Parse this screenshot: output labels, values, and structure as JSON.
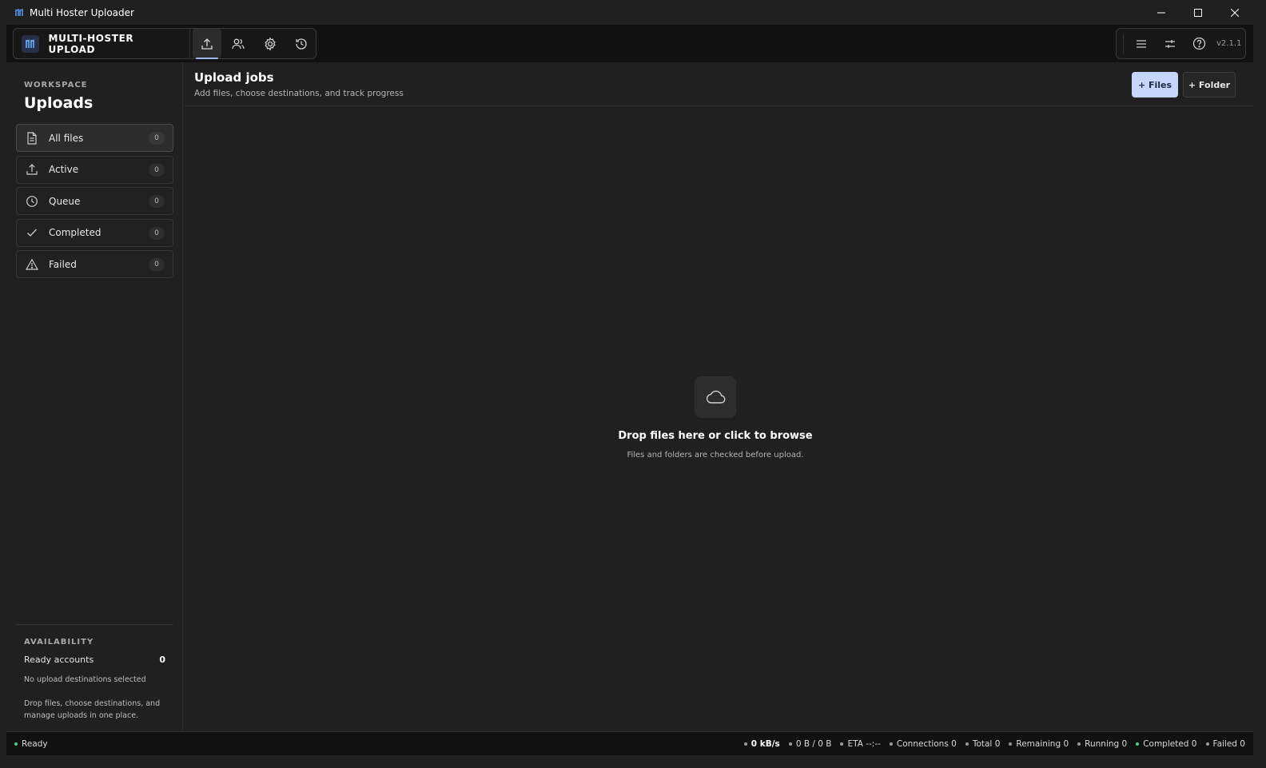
{
  "window": {
    "title": "Multi Hoster Uploader"
  },
  "header": {
    "brand": "MULTI-HOSTER UPLOAD",
    "nav": [
      "upload",
      "accounts",
      "settings",
      "history"
    ],
    "version": "v2.1.1"
  },
  "sidebar": {
    "workspace_label": "WORKSPACE",
    "workspace_title": "Uploads",
    "items": [
      {
        "label": "All files",
        "count": "0",
        "icon": "file-icon",
        "active": true
      },
      {
        "label": "Active",
        "count": "0",
        "icon": "upload-icon"
      },
      {
        "label": "Queue",
        "count": "0",
        "icon": "clock-icon"
      },
      {
        "label": "Completed",
        "count": "0",
        "icon": "check-icon"
      },
      {
        "label": "Failed",
        "count": "0",
        "icon": "warning-icon"
      }
    ],
    "availability_label": "AVAILABILITY",
    "ready_accounts_label": "Ready accounts",
    "ready_accounts_value": "0",
    "no_destinations": "No upload destinations selected",
    "hint": "Drop files, choose destinations, and manage uploads in one place."
  },
  "main": {
    "title": "Upload jobs",
    "subtitle": "Add files, choose destinations, and track progress",
    "add_files_label": "+ Files",
    "add_folder_label": "+ Folder",
    "drop_title": "Drop files here or click to browse",
    "drop_subtitle": "Files and folders are checked before upload."
  },
  "status": {
    "ready": "Ready",
    "speed": "0 kB/s",
    "transferred": "0 B / 0 B",
    "eta": "ETA --:--",
    "connections": "Connections 0",
    "total": "Total 0",
    "remaining": "Remaining 0",
    "running": "Running 0",
    "completed": "Completed 0",
    "failed": "Failed 0"
  },
  "colors": {
    "accent": "#c6d6fb",
    "ready_dot": "#4bd37b",
    "background": "#202020",
    "toolbar": "#111111"
  }
}
